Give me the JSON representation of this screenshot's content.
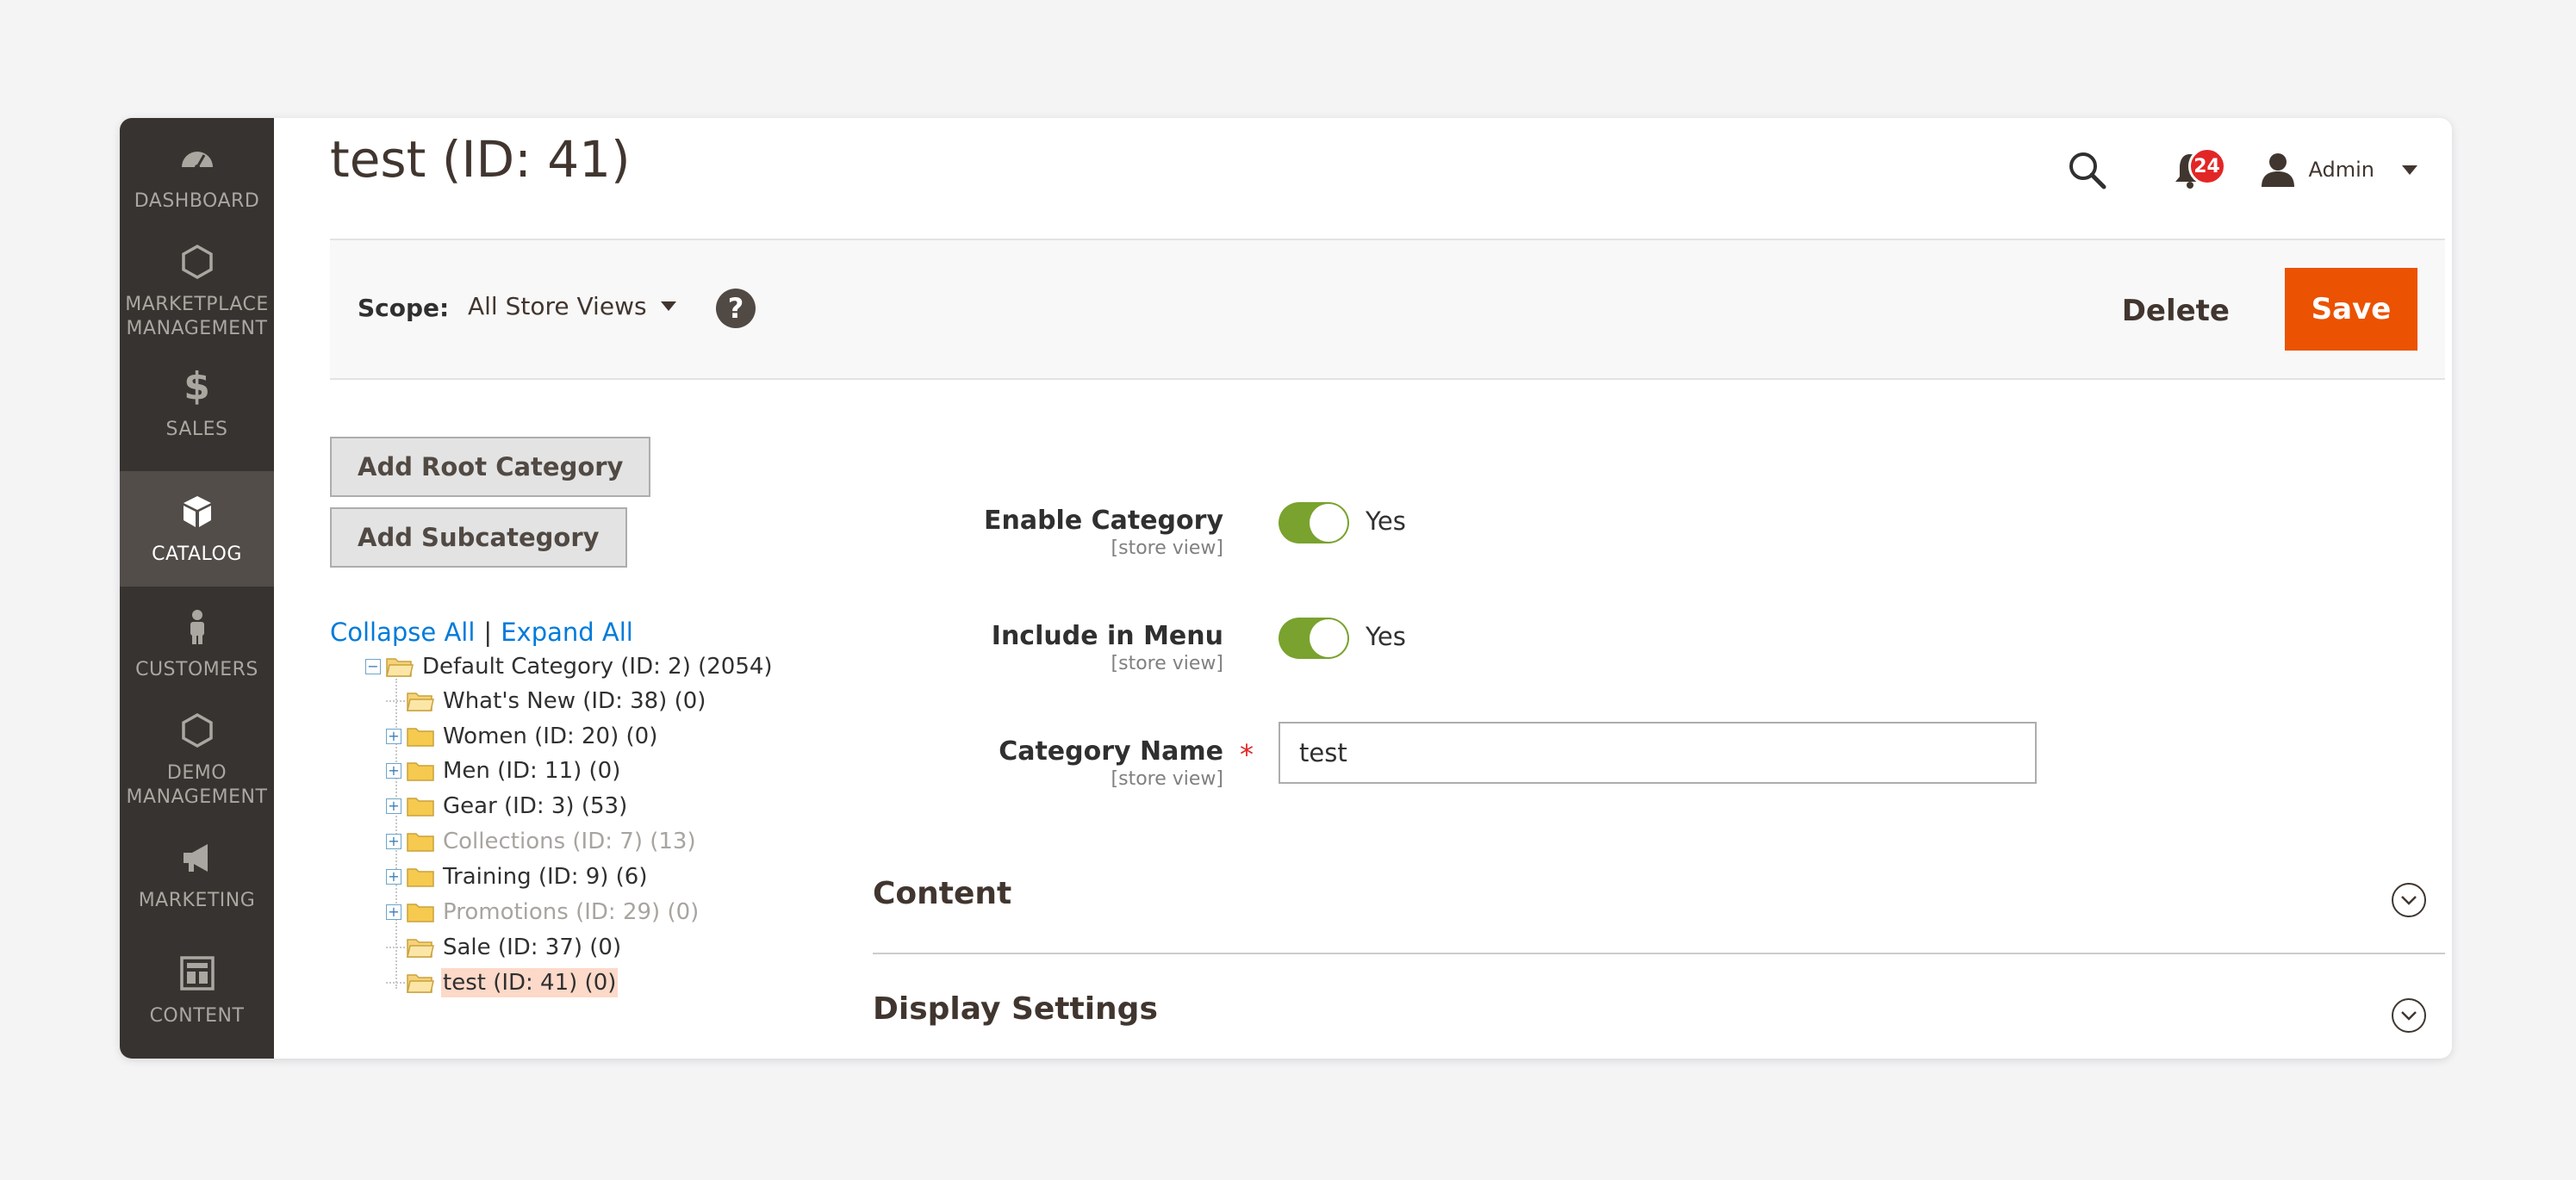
{
  "sidebar": {
    "items": [
      {
        "label": "DASHBOARD",
        "icon": "speedometer-icon"
      },
      {
        "label": "MARKETPLACE\nMANAGEMENT",
        "icon": "hexagon-icon"
      },
      {
        "label": "SALES",
        "icon": "dollar-icon"
      },
      {
        "label": "CATALOG",
        "icon": "box-icon"
      },
      {
        "label": "CUSTOMERS",
        "icon": "person-icon"
      },
      {
        "label": "DEMO\nMANAGEMENT",
        "icon": "hexagon-icon"
      },
      {
        "label": "MARKETING",
        "icon": "megaphone-icon"
      },
      {
        "label": "CONTENT",
        "icon": "layout-icon"
      }
    ],
    "dollar_symbol": "$"
  },
  "header": {
    "title": "test (ID: 41)",
    "notifications_count": "24",
    "user_name": "Admin"
  },
  "scope_bar": {
    "label": "Scope:",
    "value": "All Store Views",
    "help": "?",
    "delete_label": "Delete",
    "save_label": "Save"
  },
  "tree_panel": {
    "add_root_label": "Add Root Category",
    "add_sub_label": "Add Subcategory",
    "collapse_all": "Collapse All",
    "separator": "|",
    "expand_all": "Expand All",
    "root": "Default Category (ID: 2) (2054)",
    "children": [
      {
        "text": "What's New (ID: 38) (0)",
        "expandable": false,
        "disabled": false,
        "selected": false
      },
      {
        "text": "Women (ID: 20) (0)",
        "expandable": true,
        "disabled": false,
        "selected": false
      },
      {
        "text": "Men (ID: 11) (0)",
        "expandable": true,
        "disabled": false,
        "selected": false
      },
      {
        "text": "Gear (ID: 3) (53)",
        "expandable": true,
        "disabled": false,
        "selected": false
      },
      {
        "text": "Collections (ID: 7) (13)",
        "expandable": true,
        "disabled": true,
        "selected": false
      },
      {
        "text": "Training (ID: 9) (6)",
        "expandable": true,
        "disabled": false,
        "selected": false
      },
      {
        "text": "Promotions (ID: 29) (0)",
        "expandable": true,
        "disabled": true,
        "selected": false
      },
      {
        "text": "Sale (ID: 37) (0)",
        "expandable": false,
        "disabled": false,
        "selected": false
      },
      {
        "text": "test (ID: 41) (0)",
        "expandable": false,
        "disabled": false,
        "selected": true
      }
    ]
  },
  "form": {
    "enable_category": {
      "label": "Enable Category",
      "scope": "[store view]",
      "value": "Yes"
    },
    "include_in_menu": {
      "label": "Include in Menu",
      "scope": "[store view]",
      "value": "Yes"
    },
    "category_name": {
      "label": "Category Name",
      "scope": "[store view]",
      "required": "*",
      "value": "test"
    }
  },
  "sections": {
    "content": "Content",
    "display_settings": "Display Settings"
  },
  "colors": {
    "sidebar_bg": "#373330",
    "sidebar_active": "#524d49",
    "accent": "#eb5202",
    "toggle_on": "#79a22e",
    "link": "#007bdb",
    "badge": "#e22626"
  }
}
